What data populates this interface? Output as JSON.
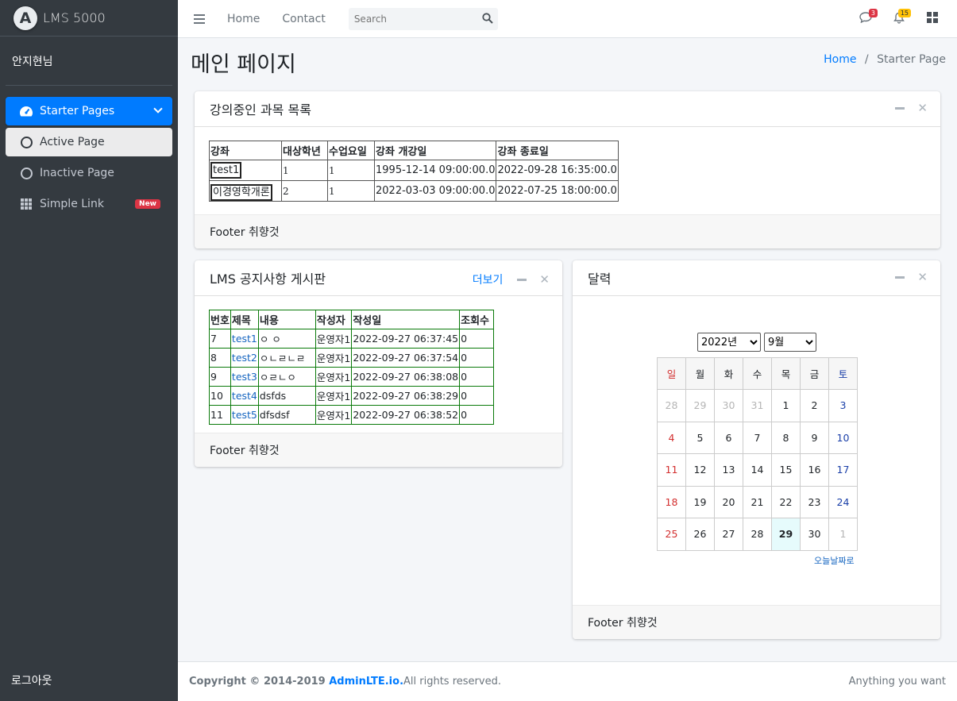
{
  "brand": {
    "logo_letter": "A",
    "name": "LMS 5000"
  },
  "user": {
    "name": "안지현님"
  },
  "nav": {
    "items": [
      {
        "label": "Starter Pages",
        "icon": "tachometer-icon"
      },
      {
        "label": "Active Page",
        "icon": "circle-icon"
      },
      {
        "label": "Inactive Page",
        "icon": "circle-icon"
      },
      {
        "label": "Simple Link",
        "icon": "th-icon",
        "badge": "New"
      }
    ]
  },
  "logout": "로그아웃",
  "topnav": {
    "home": "Home",
    "contact": "Contact",
    "search_placeholder": "Search",
    "messages_count": "3",
    "notifications_count": "15"
  },
  "page": {
    "title": "메인 페이지",
    "breadcrumb_home": "Home",
    "breadcrumb_current": "Starter Page"
  },
  "courses": {
    "title": "강의중인 과목 목록",
    "headers": [
      "강좌",
      "대상학년",
      "수업요일",
      "강좌 개강일",
      "강좌 종료일"
    ],
    "rows": [
      [
        "test1",
        "1",
        "1",
        "1995-12-14 09:00:00.0",
        "2022-09-28 16:35:00.0"
      ],
      [
        "이경영학개론",
        "2",
        "1",
        "2022-03-03 09:00:00.0",
        "2022-07-25 18:00:00.0"
      ]
    ],
    "footer": "Footer 취향것"
  },
  "notices": {
    "title": "LMS 공지사항 게시판",
    "more": "더보기",
    "headers": [
      "번호",
      "제목",
      "내용",
      "작성자",
      "작성일",
      "조회수"
    ],
    "rows": [
      [
        "7",
        "test1",
        "ㅇ ㅇ",
        "운영자1",
        "2022-09-27 06:37:45",
        "0"
      ],
      [
        "8",
        "test2",
        "ㅇㄴㄹㄴㄹ",
        "운영자1",
        "2022-09-27 06:37:54",
        "0"
      ],
      [
        "9",
        "test3",
        "ㅇㄹㄴㅇ",
        "운영자1",
        "2022-09-27 06:38:08",
        "0"
      ],
      [
        "10",
        "test4",
        "dsfds",
        "운영자1",
        "2022-09-27 06:38:29",
        "0"
      ],
      [
        "11",
        "test5",
        "dfsdsf",
        "운영자1",
        "2022-09-27 06:38:52",
        "0"
      ]
    ],
    "footer": "Footer 취향것"
  },
  "calendar": {
    "title": "달력",
    "year_selected": "2022년",
    "month_selected": "9월",
    "weekdays": [
      "일",
      "월",
      "화",
      "수",
      "목",
      "금",
      "토"
    ],
    "weeks": [
      [
        "28",
        "29",
        "30",
        "31",
        "1",
        "2",
        "3"
      ],
      [
        "4",
        "5",
        "6",
        "7",
        "8",
        "9",
        "10"
      ],
      [
        "11",
        "12",
        "13",
        "14",
        "15",
        "16",
        "17"
      ],
      [
        "18",
        "19",
        "20",
        "21",
        "22",
        "23",
        "24"
      ],
      [
        "25",
        "26",
        "27",
        "28",
        "29",
        "30",
        "1"
      ]
    ],
    "today": "29",
    "today_link": "오늘날짜로",
    "footer": "Footer 취향것"
  },
  "footer": {
    "copyright_prefix": "Copyright © 2014-2019 ",
    "copyright_link": "AdminLTE.io.",
    "copyright_suffix": " All rights reserved.",
    "right": "Anything you want"
  },
  "colors": {
    "accent": "#007bff",
    "sidebar": "#343a40",
    "danger": "#dc3545",
    "warning": "#ffc107"
  }
}
